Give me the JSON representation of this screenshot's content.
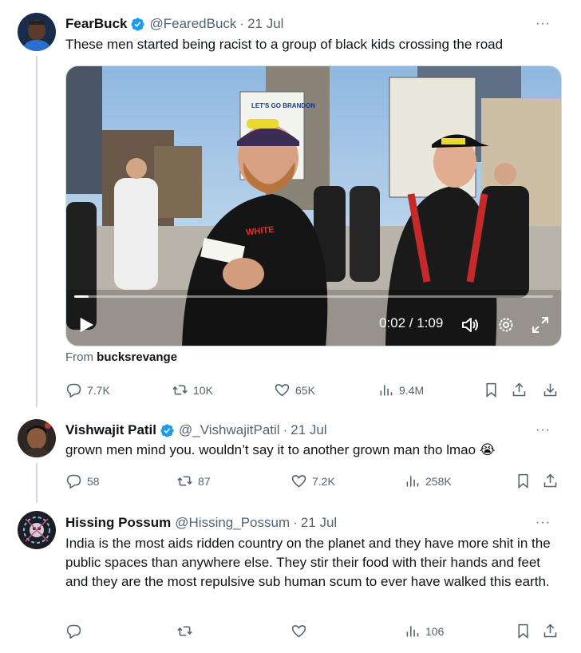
{
  "tweets": [
    {
      "name": "FearBuck",
      "handle": "@FearedBuck",
      "date": "21 Jul",
      "more": "···",
      "text": "These men started being racist to a group of black kids crossing the road",
      "video": {
        "time": "0:02 / 1:09",
        "progress": 0.03,
        "sign_text": "LET'S GO BRANDON",
        "shirt_text": "WHITE"
      },
      "from_label": "From",
      "from_account": "bucksrevange",
      "stats": {
        "replies": "7.7K",
        "reposts": "10K",
        "likes": "65K",
        "views": "9.4M"
      }
    },
    {
      "name": "Vishwajit Patil",
      "handle": "@_VishwajitPatil",
      "date": "21 Jul",
      "more": "···",
      "text": "grown men mind you. wouldn’t say it to another grown man tho lmao 😭",
      "stats": {
        "replies": "58",
        "reposts": "87",
        "likes": "7.2K",
        "views": "258K"
      }
    },
    {
      "name": "Hissing Possum",
      "handle": "@Hissing_Possum",
      "date": "21 Jul",
      "more": "···",
      "text": "India is the most aids ridden country on the planet and they have more shit in the public spaces than anywhere else. They stir their food with their hands and feet and they are the most repulsive sub human scum to ever have walked this earth.",
      "stats": {
        "views": "106"
      }
    }
  ],
  "colors": {
    "verified": "#1d9bf0",
    "muted": "#536471",
    "thread_line": "#cfd9de"
  }
}
